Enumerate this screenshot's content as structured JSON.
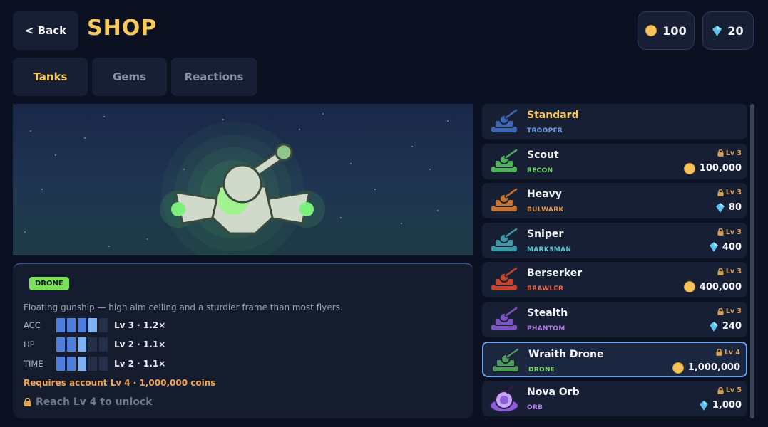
{
  "header": {
    "back_label": "< Back",
    "title": "SHOP",
    "coins": "100",
    "gems": "20"
  },
  "tabs": [
    {
      "label": "Tanks",
      "active": true
    },
    {
      "label": "Gems",
      "active": false
    },
    {
      "label": "Reactions",
      "active": false
    }
  ],
  "details": {
    "badge": "DRONE",
    "description": "Floating gunship — high aim ceiling and a sturdier frame than most flyers.",
    "stats": [
      {
        "label": "ACC",
        "value": "Lv 3 · 1.2×",
        "level": 4,
        "max": 5
      },
      {
        "label": "HP",
        "value": "Lv 2 · 1.1×",
        "level": 3,
        "max": 5
      },
      {
        "label": "TIME",
        "value": "Lv 2 · 1.1×",
        "level": 3,
        "max": 5
      }
    ],
    "requirement": "Requires account Lv 4  ·  1,000,000 coins",
    "unlock_text": "Reach Lv 4 to unlock"
  },
  "tanks": [
    {
      "name": "Standard",
      "class": "TROOPER",
      "class_color": "#6b9be3",
      "icon": "standard-tank-icon",
      "body_color": "#3f66b5",
      "level": "",
      "price": "",
      "currency": "",
      "owned": true
    },
    {
      "name": "Scout",
      "class": "RECON",
      "class_color": "#6fd66a",
      "icon": "scout-tank-icon",
      "body_color": "#4fb35a",
      "level": "Lv 3",
      "price": "100,000",
      "currency": "coin"
    },
    {
      "name": "Heavy",
      "class": "BULWARK",
      "class_color": "#e8984a",
      "icon": "heavy-tank-icon",
      "body_color": "#c9742f",
      "level": "Lv 3",
      "price": "80",
      "currency": "gem"
    },
    {
      "name": "Sniper",
      "class": "MARKSMAN",
      "class_color": "#5fc6cf",
      "icon": "sniper-tank-icon",
      "body_color": "#3b9aa6",
      "level": "Lv 3",
      "price": "400",
      "currency": "gem"
    },
    {
      "name": "Berserker",
      "class": "BRAWLER",
      "class_color": "#e86a4d",
      "icon": "berserker-tank-icon",
      "body_color": "#c5452f",
      "level": "Lv 3",
      "price": "400,000",
      "currency": "coin"
    },
    {
      "name": "Stealth",
      "class": "PHANTOM",
      "class_color": "#b07fe6",
      "icon": "stealth-tank-icon",
      "body_color": "#7e54c4",
      "level": "Lv 3",
      "price": "240",
      "currency": "gem"
    },
    {
      "name": "Wraith Drone",
      "class": "DRONE",
      "class_color": "#79d96a",
      "icon": "wraith-drone-icon",
      "body_color": "#4d9a5a",
      "level": "Lv 4",
      "price": "1,000,000",
      "currency": "coin",
      "selected": true
    },
    {
      "name": "Nova Orb",
      "class": "ORB",
      "class_color": "#b784ee",
      "icon": "nova-orb-icon",
      "body_color": "#8b5fd6",
      "level": "Lv 5",
      "price": "1,000",
      "currency": "gem"
    }
  ]
}
